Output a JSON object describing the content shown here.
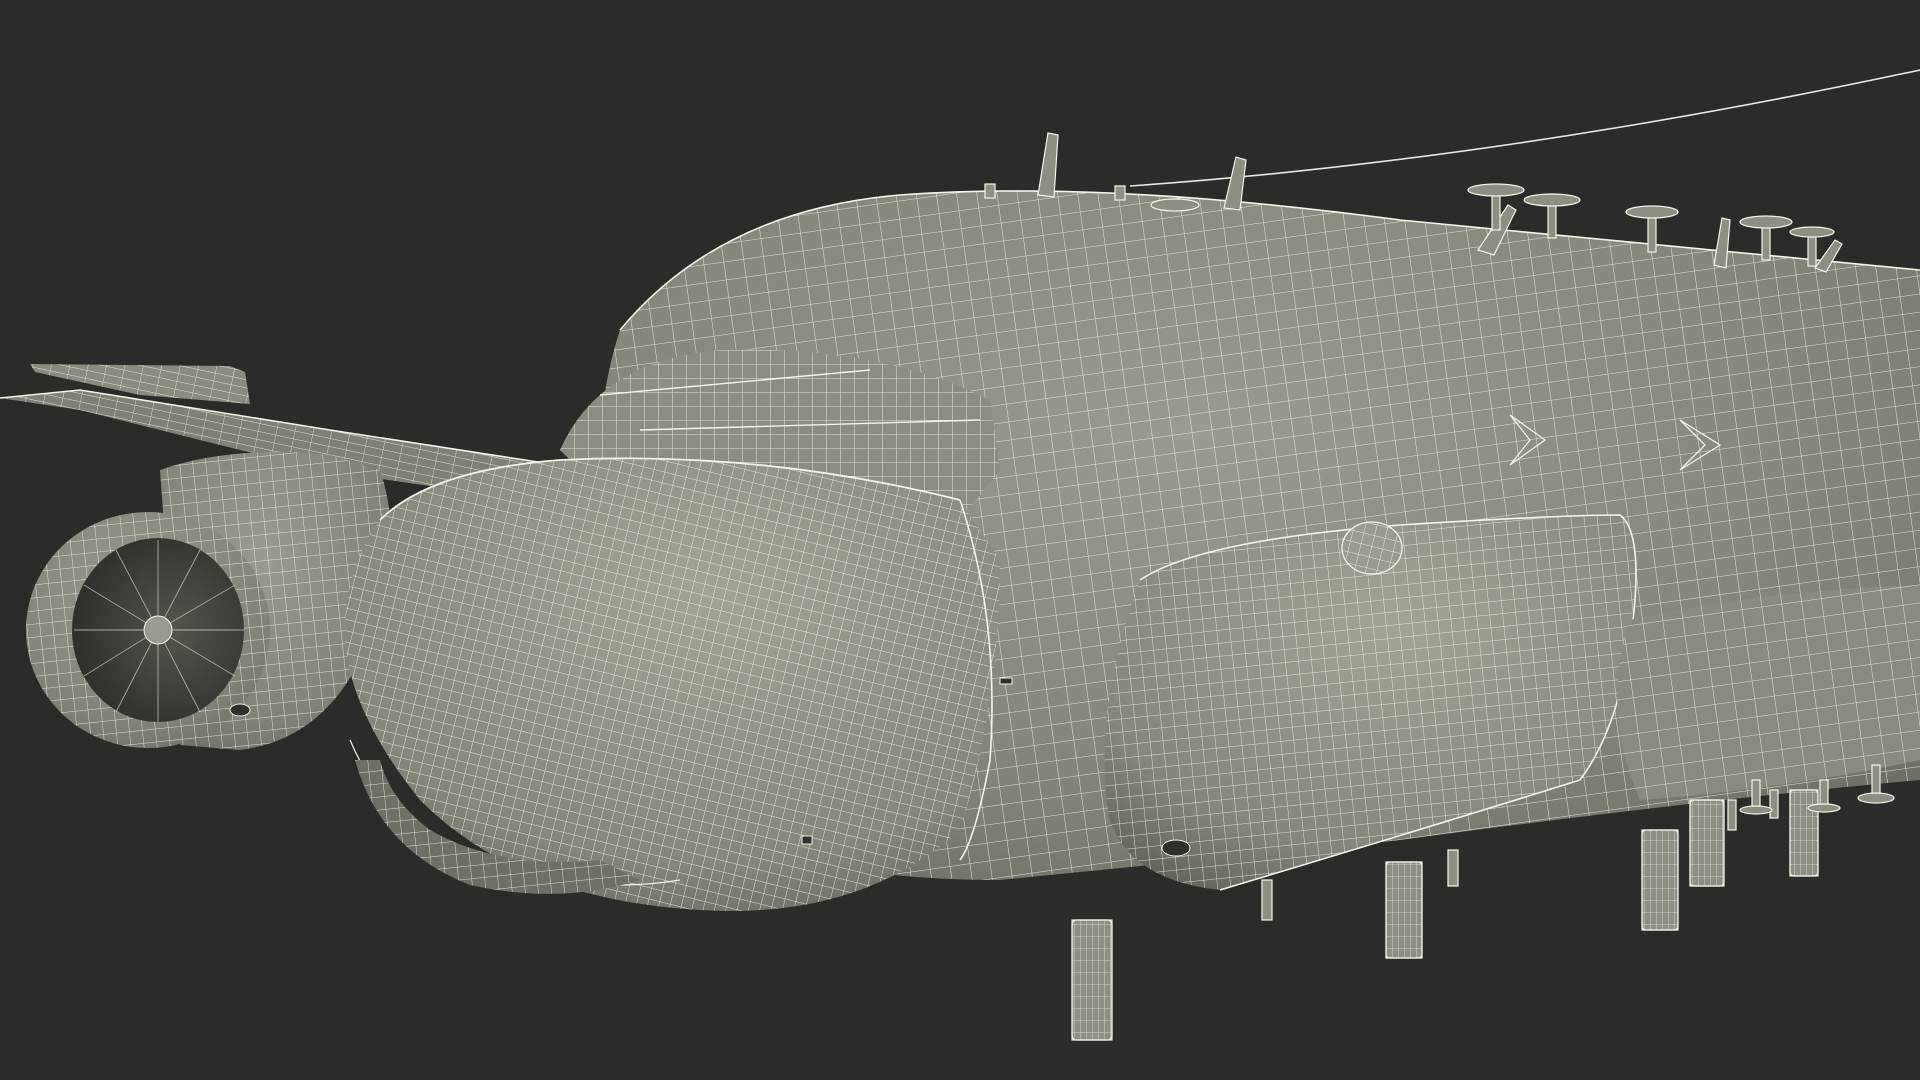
{
  "colors": {
    "background": "#2b2b2a",
    "mesh_fill": "#7f7f74",
    "mesh_fill_light": "#96968a",
    "mesh_fill_dark": "#5f5f56",
    "wire": "#f4f4ea",
    "intake_dark": "#3e3e39"
  },
  "scene": {
    "subject": "aircraft-wireframe-model",
    "style": "quad-wireframe"
  }
}
